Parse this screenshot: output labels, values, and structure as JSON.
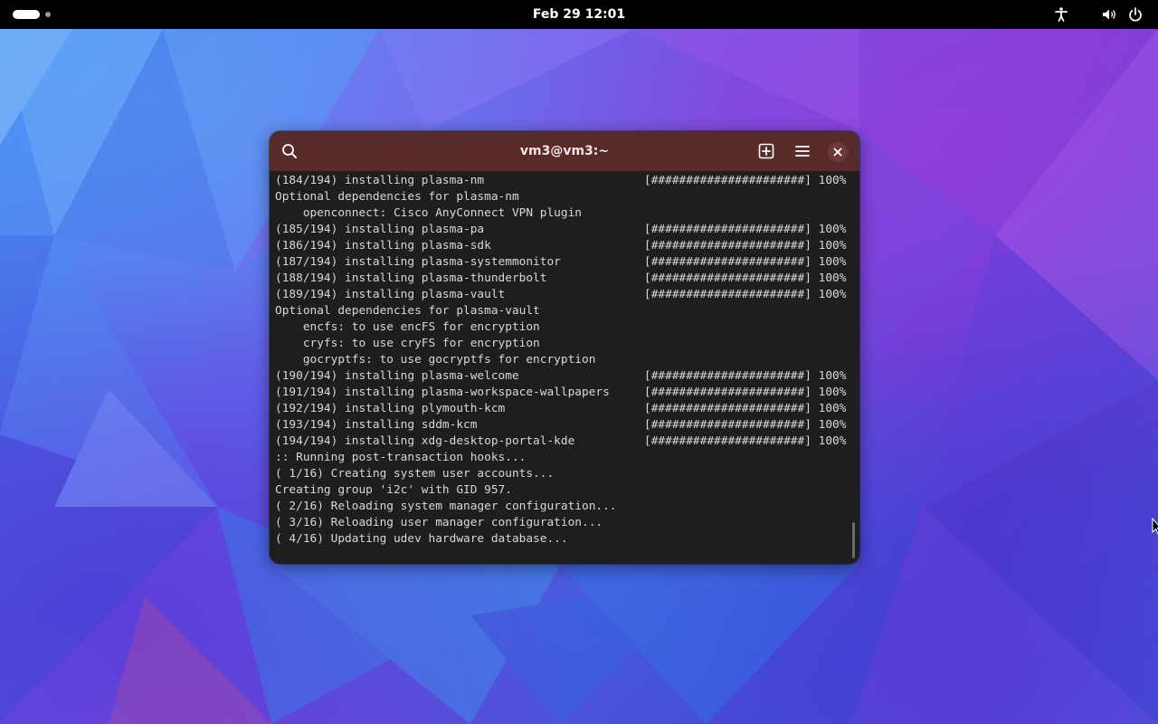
{
  "topbar": {
    "date": "Feb 29",
    "time": "12:01",
    "icons": [
      "accessibility-icon",
      "volume-icon",
      "power-icon"
    ]
  },
  "window": {
    "title": "vm3@vm3:~",
    "icons": [
      "search-icon",
      "new-tab-icon",
      "menu-icon",
      "close-icon"
    ],
    "header_color": "#582b2b",
    "terminal_bg": "#1e1e1e"
  },
  "terminal": {
    "lines": [
      {
        "text": "(184/194) installing plasma-nm",
        "progress": "[######################] 100%"
      },
      {
        "text": "Optional dependencies for plasma-nm",
        "progress": ""
      },
      {
        "text": "    openconnect: Cisco AnyConnect VPN plugin",
        "progress": ""
      },
      {
        "text": "(185/194) installing plasma-pa",
        "progress": "[######################] 100%"
      },
      {
        "text": "(186/194) installing plasma-sdk",
        "progress": "[######################] 100%"
      },
      {
        "text": "(187/194) installing plasma-systemmonitor",
        "progress": "[######################] 100%"
      },
      {
        "text": "(188/194) installing plasma-thunderbolt",
        "progress": "[######################] 100%"
      },
      {
        "text": "(189/194) installing plasma-vault",
        "progress": "[######################] 100%"
      },
      {
        "text": "Optional dependencies for plasma-vault",
        "progress": ""
      },
      {
        "text": "    encfs: to use encFS for encryption",
        "progress": ""
      },
      {
        "text": "    cryfs: to use cryFS for encryption",
        "progress": ""
      },
      {
        "text": "    gocryptfs: to use gocryptfs for encryption",
        "progress": ""
      },
      {
        "text": "(190/194) installing plasma-welcome",
        "progress": "[######################] 100%"
      },
      {
        "text": "(191/194) installing plasma-workspace-wallpapers",
        "progress": "[######################] 100%"
      },
      {
        "text": "(192/194) installing plymouth-kcm",
        "progress": "[######################] 100%"
      },
      {
        "text": "(193/194) installing sddm-kcm",
        "progress": "[######################] 100%"
      },
      {
        "text": "(194/194) installing xdg-desktop-portal-kde",
        "progress": "[######################] 100%"
      },
      {
        "text": ":: Running post-transaction hooks...",
        "progress": ""
      },
      {
        "text": "( 1/16) Creating system user accounts...",
        "progress": ""
      },
      {
        "text": "Creating group 'i2c' with GID 957.",
        "progress": ""
      },
      {
        "text": "( 2/16) Reloading system manager configuration...",
        "progress": ""
      },
      {
        "text": "( 3/16) Reloading user manager configuration...",
        "progress": ""
      },
      {
        "text": "( 4/16) Updating udev hardware database...",
        "progress": ""
      }
    ]
  }
}
